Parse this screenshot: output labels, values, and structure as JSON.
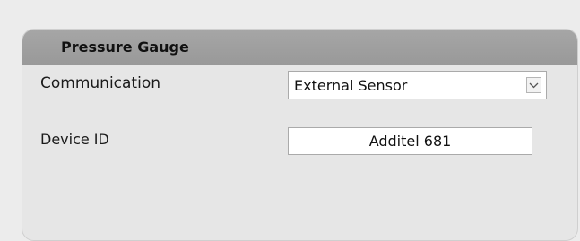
{
  "panel": {
    "title": "Pressure Gauge"
  },
  "communication": {
    "label": "Communication",
    "selected": "External Sensor",
    "icon": "chevron-down-icon"
  },
  "device_id": {
    "label": "Device ID",
    "value": "Additel 681"
  }
}
